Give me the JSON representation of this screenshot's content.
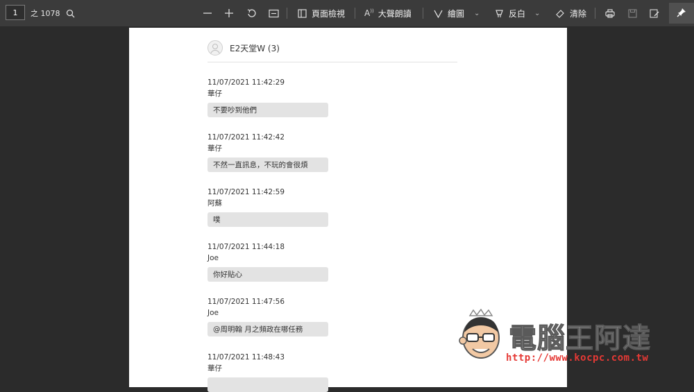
{
  "toolbar": {
    "page_current": "1",
    "page_total": "之 1078",
    "page_view_label": "頁面檢視",
    "read_aloud_label": "大聲朗讀",
    "draw_label": "繪圖",
    "highlight_label": "反白",
    "erase_label": "清除"
  },
  "chat": {
    "title": "E2天堂W (3)",
    "messages": [
      {
        "time": "11/07/2021 11:42:29",
        "sender": "華仔",
        "text": "不要吵到他們"
      },
      {
        "time": "11/07/2021 11:42:42",
        "sender": "華仔",
        "text": "不然一直訊息，不玩的會很煩"
      },
      {
        "time": "11/07/2021 11:42:59",
        "sender": "阿蘇",
        "text": "噗"
      },
      {
        "time": "11/07/2021 11:44:18",
        "sender": "Joe",
        "text": "你好貼心"
      },
      {
        "time": "11/07/2021 11:47:56",
        "sender": "Joe",
        "text": "@周明翰 月之頻政在哪任務"
      },
      {
        "time": "11/07/2021 11:48:43",
        "sender": "華仔",
        "text": ""
      }
    ]
  },
  "watermark": {
    "brand": "電腦王阿達",
    "url": "http://www.kocpc.com.tw"
  },
  "colors": {
    "toolbar_bg": "#3b3b3b",
    "canvas_bg": "#2b2b2b",
    "bubble_bg": "#e3e3e3",
    "watermark_url": "#e53935"
  }
}
